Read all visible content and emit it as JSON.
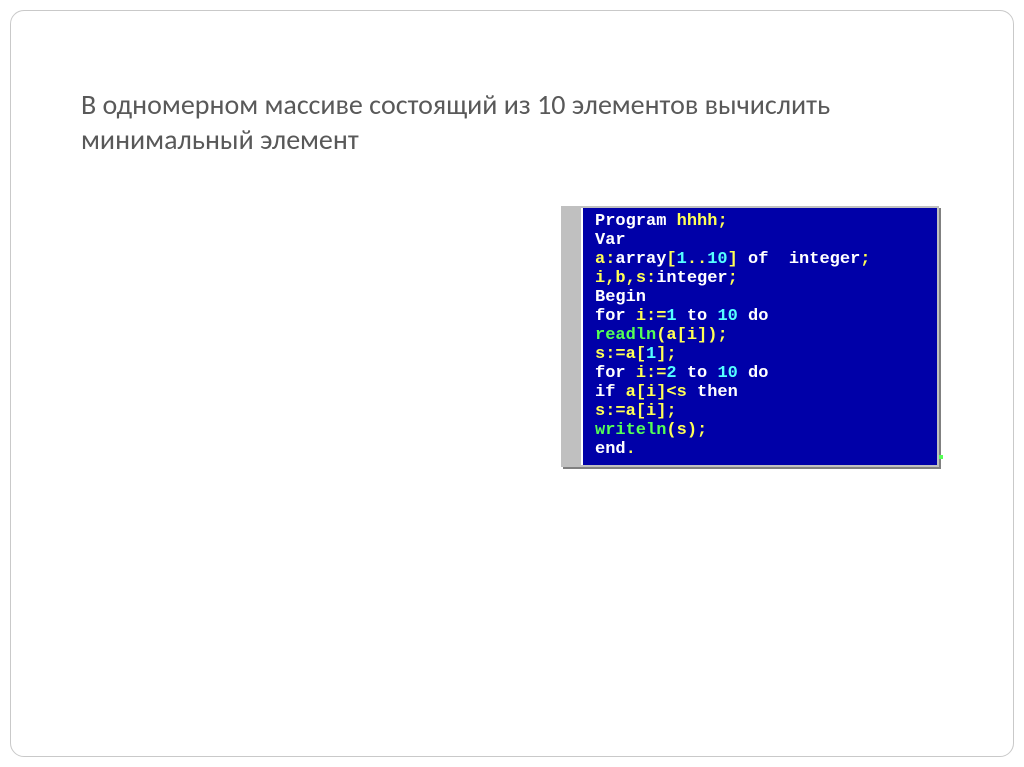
{
  "title_line1": "В одномерном массиве  состоящий из 10 элементов вычислить",
  "title_line2": "минимальный элемент",
  "code": {
    "l01": {
      "kw1": "Program",
      "id1": "hhhh",
      "sym1": ";"
    },
    "l02": {
      "kw1": "Var"
    },
    "l03": {
      "id1": "a",
      "sym1": ":",
      "kw1": "array",
      "sym2": "[",
      "num1": "1",
      "sym3": "..",
      "num2": "10",
      "sym4": "]",
      "kw2": "of",
      "kw3": "integer",
      "sym5": ";"
    },
    "l04": {
      "id1": "i",
      "sym1": ",",
      "id2": "b",
      "sym2": ",",
      "id3": "s",
      "sym3": ":",
      "kw1": "integer",
      "sym4": ";"
    },
    "l05": {
      "kw1": "Begin"
    },
    "l06": {
      "kw1": "for",
      "id1": "i",
      "sym1": ":=",
      "num1": "1",
      "kw2": "to",
      "num2": "10",
      "kw3": "do"
    },
    "l07": {
      "fn1": "readln",
      "sym1": "(",
      "id1": "a",
      "sym2": "[",
      "id2": "i",
      "sym3": "]",
      "sym4": ")",
      "sym5": ";"
    },
    "l08": {
      "id1": "s",
      "sym1": ":=",
      "id2": "a",
      "sym2": "[",
      "num1": "1",
      "sym3": "]",
      "sym4": ";"
    },
    "l09": {
      "kw1": "for",
      "id1": "i",
      "sym1": ":=",
      "num1": "2",
      "kw2": "to",
      "num2": "10",
      "kw3": "do"
    },
    "l10": {
      "kw1": "if",
      "id1": "a",
      "sym1": "[",
      "id2": "i",
      "sym2": "]",
      "sym3": "<",
      "id3": "s",
      "kw2": "then"
    },
    "l11": {
      "id1": "s",
      "sym1": ":=",
      "id2": "a",
      "sym2": "[",
      "id3": "i",
      "sym3": "]",
      "sym4": ";"
    },
    "l12": {
      "fn1": "writeln",
      "sym1": "(",
      "id1": "s",
      "sym2": ")",
      "sym3": ";"
    },
    "l13": {
      "kw1": "end",
      "sym1": "."
    }
  }
}
